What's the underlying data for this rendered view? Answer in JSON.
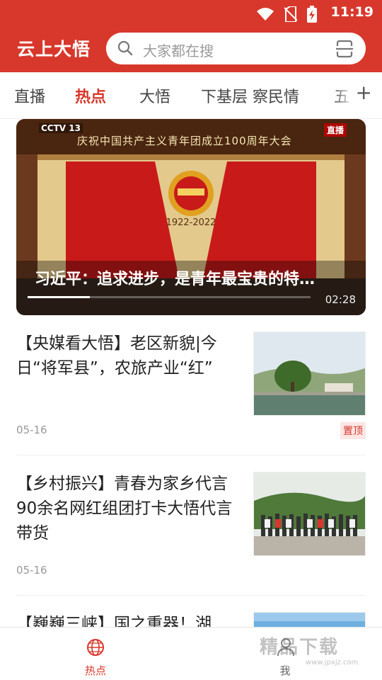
{
  "status_bar": {
    "time": "11:19"
  },
  "header": {
    "app_title": "云上大悟",
    "search_placeholder": "大家都在搜"
  },
  "tabs": {
    "items": [
      {
        "label": "直播"
      },
      {
        "label": "热点"
      },
      {
        "label": "大悟"
      },
      {
        "label": "下基层 察民情"
      },
      {
        "label": "五"
      }
    ],
    "active": "热点",
    "add_label": "+"
  },
  "featured_video": {
    "channel_badge": "CCTV 13",
    "live_badge": "直播",
    "banner_text": "庆祝中国共产主义青年团成立100周年大会",
    "emblem_years": "1922-2022",
    "caption": "习近平：追求进步，是青年最宝贵的特…",
    "duration": "02:28",
    "progress": 0.22
  },
  "news": [
    {
      "title": "【央媒看大悟】老区新貌|今日“将军县”，农旅产业“红”",
      "date": "05-16",
      "pin_label": "置顶"
    },
    {
      "title": "【乡村振兴】青春为家乡代言 90余名网红组团打卡大悟代言带货",
      "date": "05-16"
    },
    {
      "title": "【巍巍三峡】国之重器！湖"
    }
  ],
  "bottom_nav": [
    {
      "label": "热点",
      "icon": "globe-icon",
      "active": true
    },
    {
      "label": "我",
      "icon": "user-icon",
      "active": false
    }
  ],
  "watermark": {
    "text": "精品下载",
    "sub": "www.jpxjz.com"
  },
  "colors": {
    "brand_red": "#d8382c",
    "pin_bg": "#fde6e4"
  }
}
